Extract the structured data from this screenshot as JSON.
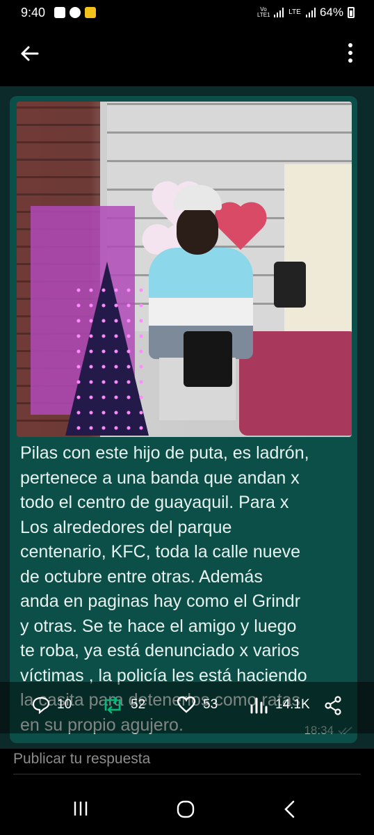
{
  "status_bar": {
    "time": "9:40",
    "network_label_1": "Vo LTE1",
    "network_label_2": "LTE",
    "battery": "64%"
  },
  "top_bar": {
    "back_icon": "arrow-left-icon",
    "menu_icon": "more-vertical-icon"
  },
  "post": {
    "image_caption_lines": [
      "Pilas con este hijo de puta, es ladrón,",
      "pertenece a una banda que andan x",
      "todo el centro de guayaquil. Para x",
      "Los alrededores del parque",
      "centenario, KFC, toda la calle nueve",
      "de octubre entre otras. Además",
      "anda en paginas hay como el Grindr",
      "y otras. Se te hace el amigo y luego",
      "te roba, ya está denunciado x varios",
      "víctimas , la policía les está haciendo",
      "la casita para detenerlos como ratas",
      "en su propio agujero."
    ],
    "message_time": "18:34"
  },
  "engagement": {
    "replies": "10",
    "reposts": "52",
    "likes": "53",
    "views": "14.1K"
  },
  "reply_bar": {
    "placeholder": "Publicar tu respuesta"
  },
  "colors": {
    "repost_green": "#00ba7c",
    "bubble_green": "#0c4f48"
  }
}
